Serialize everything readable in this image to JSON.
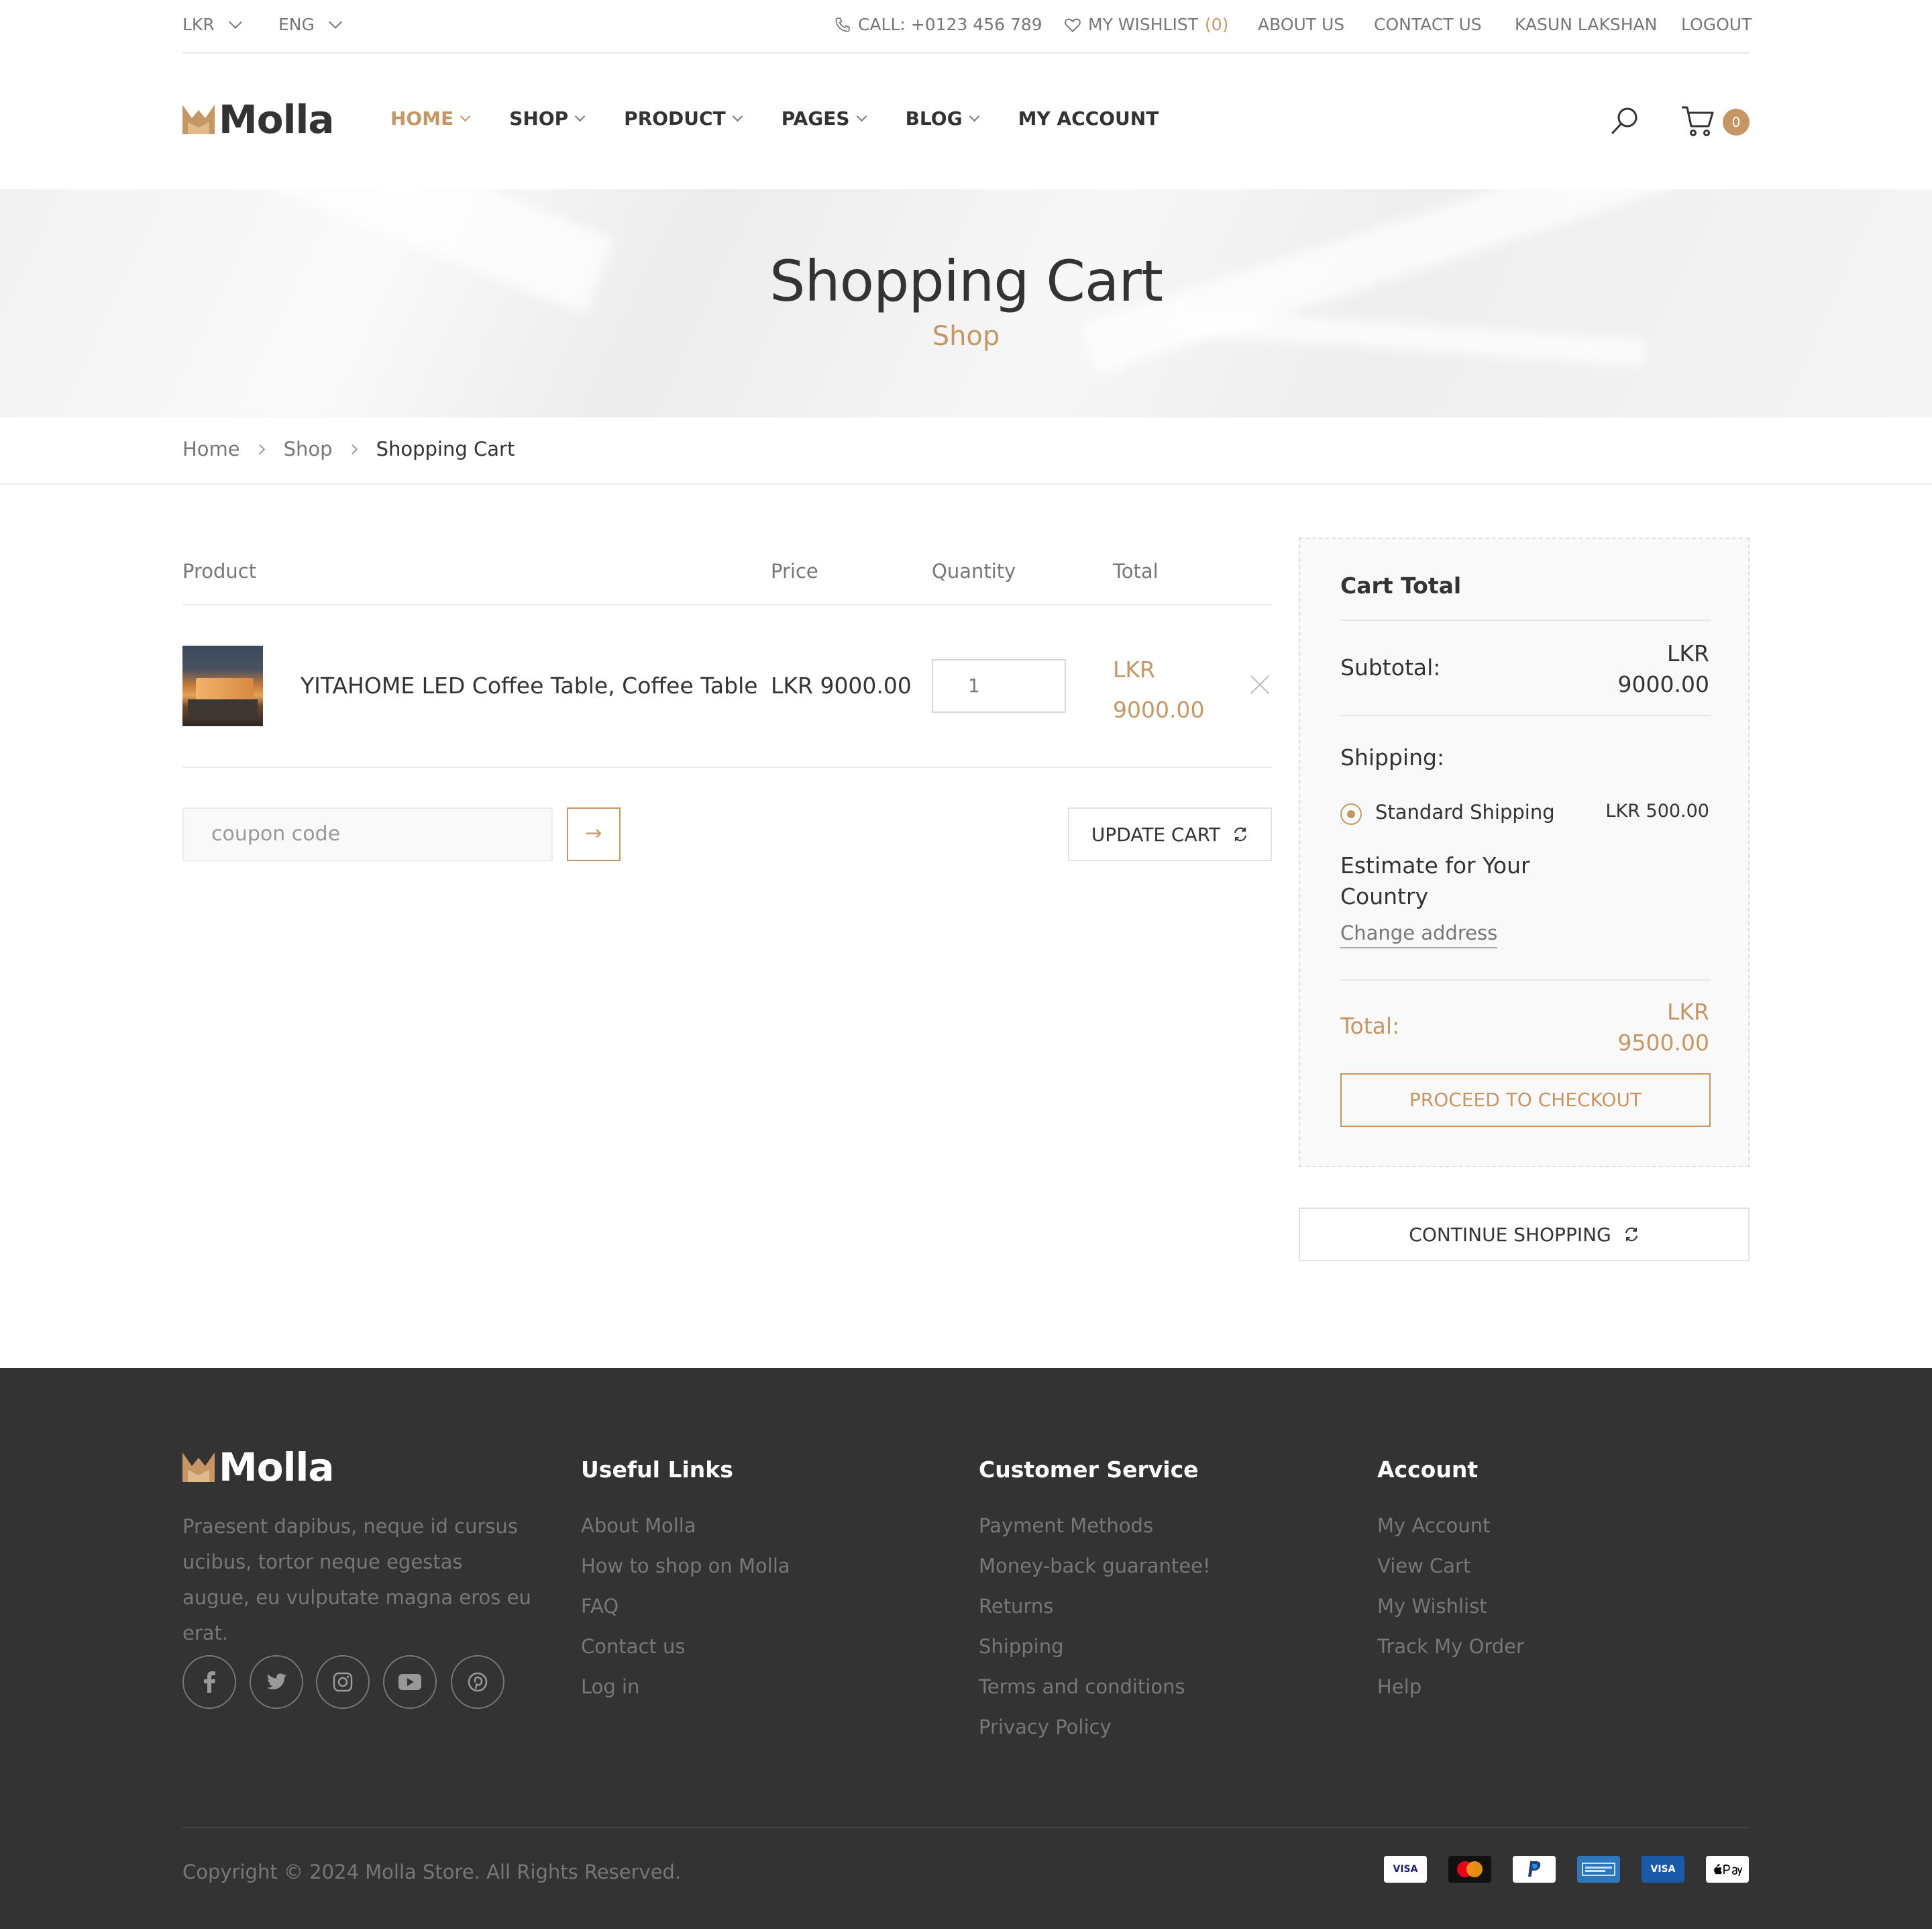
{
  "topbar": {
    "currency": "LKR",
    "language": "ENG",
    "phone": "CALL: +0123 456 789",
    "wishlist_label": "MY WISHLIST",
    "wishlist_count": "(0)",
    "about": "ABOUT US",
    "contact": "CONTACT US",
    "user": "KASUN LAKSHAN",
    "logout": "LOGOUT"
  },
  "header": {
    "logo_text": "Molla",
    "nav": [
      "HOME",
      "SHOP",
      "PRODUCT",
      "PAGES",
      "BLOG",
      "MY ACCOUNT"
    ],
    "cart_count": "0"
  },
  "hero": {
    "title": "Shopping Cart",
    "subtitle": "Shop"
  },
  "breadcrumb": [
    "Home",
    "Shop",
    "Shopping Cart"
  ],
  "cart_table": {
    "headers": [
      "Product",
      "Price",
      "Quantity",
      "Total"
    ],
    "items": [
      {
        "name": "YITAHOME LED Coffee Table, Coffee Table",
        "price": "LKR 9000.00",
        "quantity": "1",
        "total_currency": "LKR",
        "total_amount": "9000.00"
      }
    ],
    "coupon_placeholder": "coupon code",
    "coupon_button": "→",
    "update_button": "UPDATE CART"
  },
  "cart_total": {
    "title": "Cart Total",
    "subtotal_label": "Subtotal:",
    "subtotal_currency": "LKR",
    "subtotal_amount": "9000.00",
    "shipping_label": "Shipping:",
    "shipping_option": "Standard Shipping",
    "shipping_price": "LKR 500.00",
    "estimate_line1": "Estimate for Your",
    "estimate_line2": "Country",
    "change_address": "Change address",
    "total_label": "Total:",
    "total_currency": "LKR",
    "total_amount": "9500.00",
    "checkout_button": "PROCEED TO CHECKOUT",
    "continue_button": "CONTINUE SHOPPING"
  },
  "footer": {
    "logo_text": "Molla",
    "description": "Praesent dapibus, neque id cursus ucibus, tortor neque egestas augue, eu vulputate magna eros eu erat.",
    "social_icons": [
      "facebook-icon",
      "twitter-icon",
      "instagram-icon",
      "youtube-icon",
      "pinterest-icon"
    ],
    "columns": [
      {
        "title": "Useful Links",
        "links": [
          "About Molla",
          "How to shop on Molla",
          "FAQ",
          "Contact us",
          "Log in"
        ]
      },
      {
        "title": "Customer Service",
        "links": [
          "Payment Methods",
          "Money-back guarantee!",
          "Returns",
          "Shipping",
          "Terms and conditions",
          "Privacy Policy"
        ]
      },
      {
        "title": "Account",
        "links": [
          "My Account",
          "View Cart",
          "My Wishlist",
          "Track My Order",
          "Help"
        ]
      }
    ],
    "copyright": "Copyright © 2024 Molla Store. All Rights Reserved.",
    "payment_icons": [
      "visa-icon",
      "mastercard-icon",
      "paypal-icon",
      "amex-icon",
      "visa-electron-icon",
      "apple-pay-icon"
    ]
  },
  "colors": {
    "accent": "#c69764",
    "footer_bg": "#333333",
    "text": "#333333",
    "muted": "#777777"
  }
}
